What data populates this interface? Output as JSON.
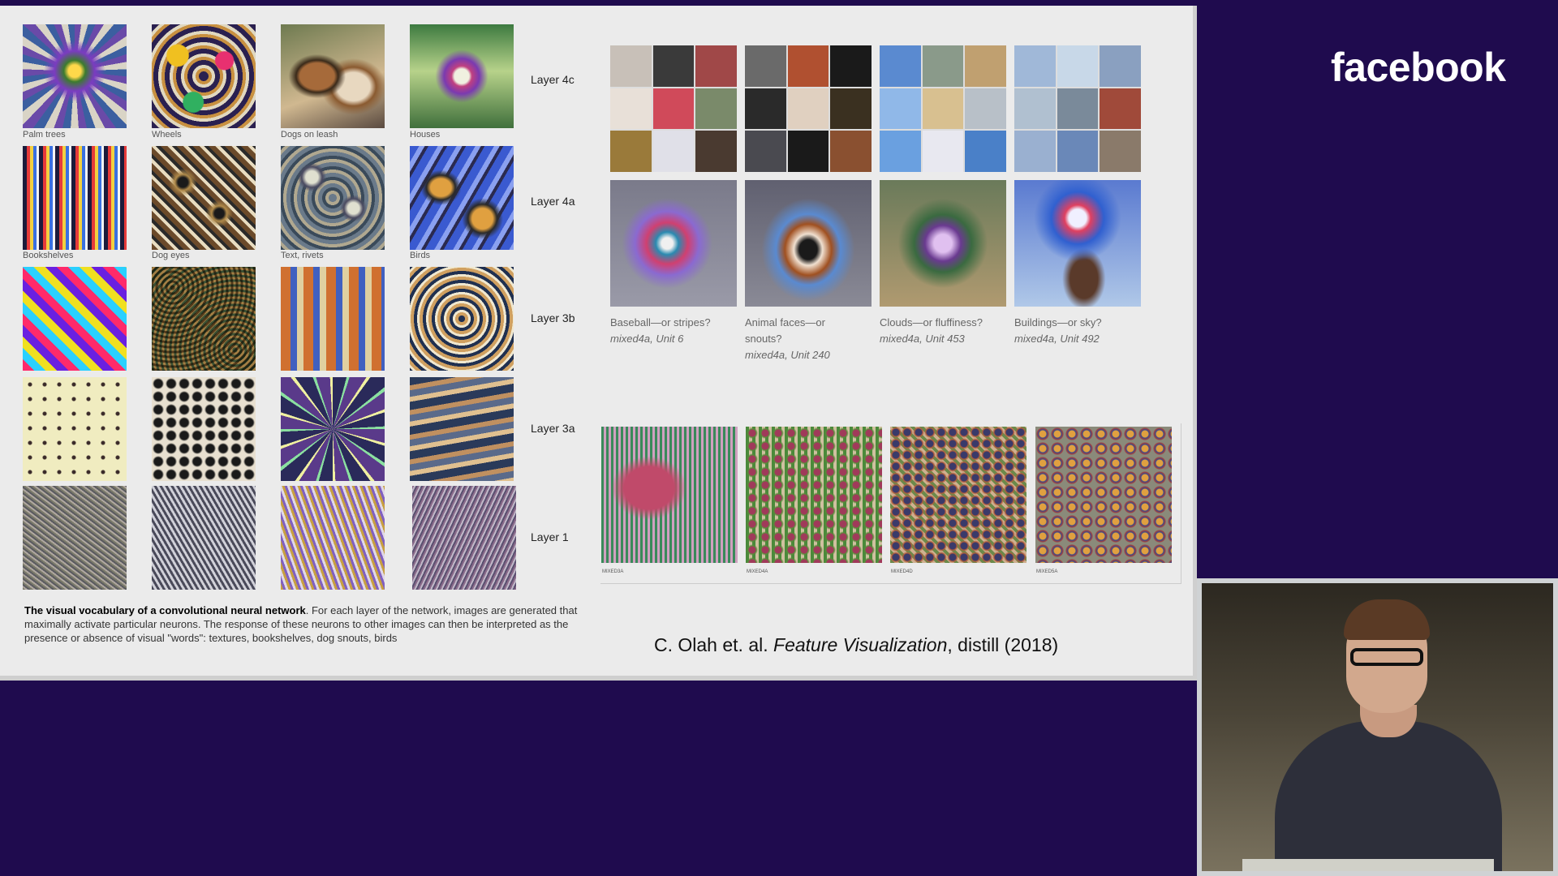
{
  "brand": {
    "logo_text": "facebook"
  },
  "left_grid": {
    "layer_labels": [
      "Layer 4c",
      "Layer 4a",
      "Layer 3b",
      "Layer 3a",
      "Layer 1"
    ],
    "captions": [
      "Palm trees",
      "Wheels",
      "Dogs on leash",
      "Houses",
      "Bookshelves",
      "Dog eyes",
      "Text, rivets",
      "Birds"
    ]
  },
  "right_top": {
    "captions": [
      {
        "title": "Baseball—or stripes?",
        "unit": "mixed4a, Unit 6"
      },
      {
        "title": "Animal faces—or snouts?",
        "unit": "mixed4a, Unit 240"
      },
      {
        "title": "Clouds—or fluffiness?",
        "unit": "mixed4a, Unit 453"
      },
      {
        "title": "Buildings—or sky?",
        "unit": "mixed4a, Unit 492"
      }
    ]
  },
  "right_bottom": {
    "labels": [
      "MIXED3A",
      "MIXED4A",
      "MIXED4D",
      "MIXED5A"
    ]
  },
  "caption": {
    "bold": "The visual vocabulary of a convolutional neural network",
    "rest": ". For each layer of the network, images are generated that maximally activate particular neurons. The response of these neurons to other images can then be interpreted as the presence or absence of visual \"words\": textures, bookshelves, dog snouts, birds"
  },
  "citation": {
    "prefix": "C. Olah et. al. ",
    "title": "Feature Visualization",
    "suffix": ", distill (2018)"
  }
}
